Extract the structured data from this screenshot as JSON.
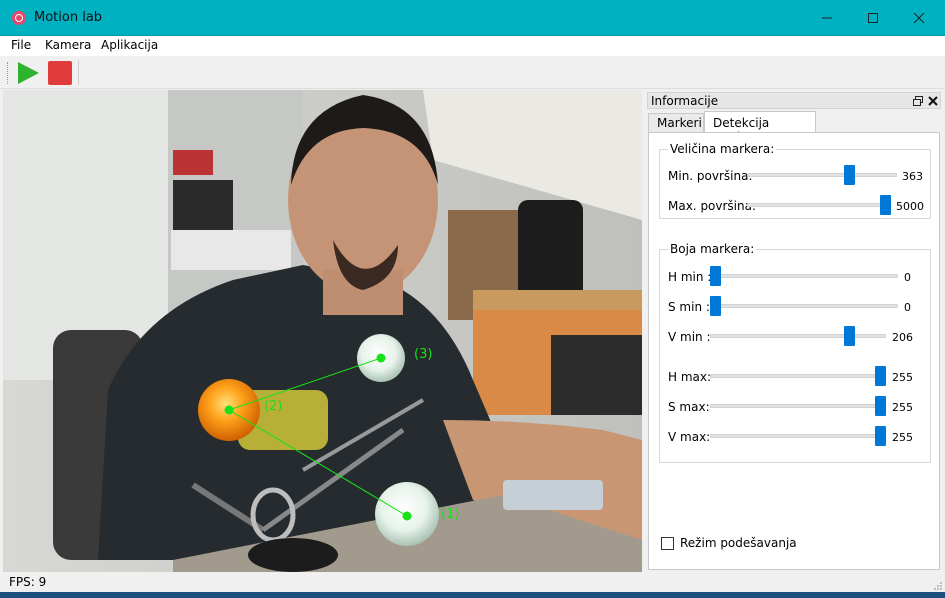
{
  "window": {
    "title": "Motion lab",
    "app_icon": "app-logo-icon",
    "accent_color": "#00b1c2"
  },
  "menu": {
    "items": [
      "File",
      "Kamera",
      "Aplikacija"
    ]
  },
  "toolbar": {
    "play_icon": "play-icon",
    "stop_icon": "stop-icon",
    "play_color": "#2fb32f",
    "stop_color": "#e03c3c"
  },
  "video": {
    "markers": [
      {
        "label": "(1)",
        "color": "#e8f0ea"
      },
      {
        "label": "(2)",
        "color": "#ff9b10"
      },
      {
        "label": "(3)",
        "color": "#e8f0ea"
      }
    ],
    "overlay_color": "#19e019"
  },
  "dock": {
    "title": "Informacije",
    "tabs": [
      "Markeri",
      "Detekcija markera"
    ],
    "active_tab": "Detekcija markera",
    "size_group": {
      "title": "Veličina markera:",
      "rows": [
        {
          "label": "Min. površina:",
          "value": "363",
          "fraction": 0.7
        },
        {
          "label": "Max. površina:",
          "value": "5000",
          "fraction": 1.0
        }
      ]
    },
    "color_group": {
      "title": "Boja markera:",
      "rows": [
        {
          "label": "H min  :",
          "value": "0",
          "fraction": 0.0
        },
        {
          "label": "S min  :",
          "value": "0",
          "fraction": 0.0
        },
        {
          "label": "V min  :",
          "value": "206",
          "fraction": 0.81
        },
        {
          "label": "H max:",
          "value": "255",
          "fraction": 1.0
        },
        {
          "label": "S max:",
          "value": "255",
          "fraction": 1.0
        },
        {
          "label": "V max:",
          "value": "255",
          "fraction": 1.0
        }
      ]
    },
    "tuning_checkbox": {
      "label": "Režim podešavanja",
      "checked": false
    }
  },
  "status": {
    "fps": "FPS: 9"
  }
}
